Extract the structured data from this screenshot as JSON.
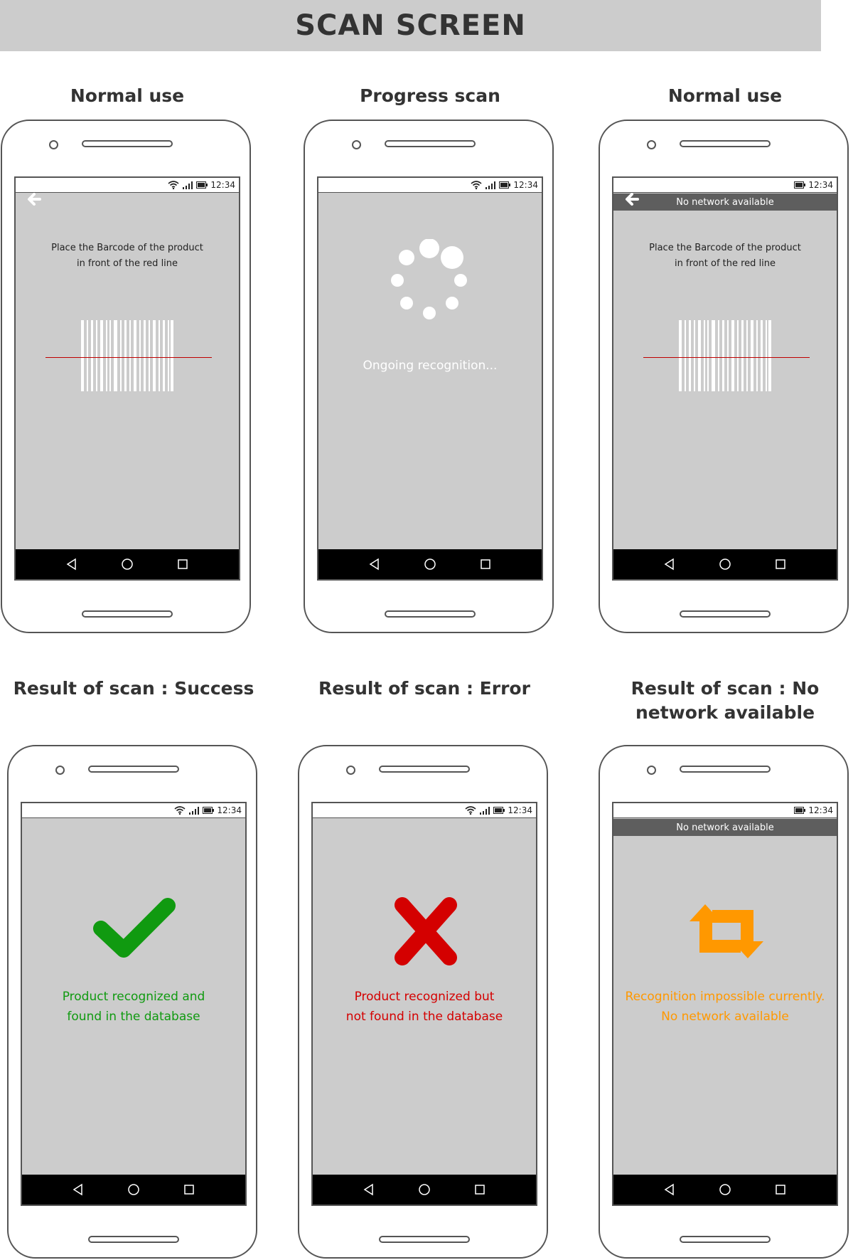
{
  "page": {
    "title": "SCAN SCREEN"
  },
  "status": {
    "time": "12:34"
  },
  "colors": {
    "success": "#109a10",
    "error": "#d40000",
    "warning": "#ff9800",
    "screen": "#cccccc",
    "scan_line": "#c00000"
  },
  "icons": {
    "wifi": "wifi-icon",
    "signal": "signal-icon",
    "battery": "battery-icon",
    "back": "back-arrow-icon",
    "nav_back": "nav-back-icon",
    "nav_home": "nav-home-icon",
    "nav_recent": "nav-recent-icon",
    "spinner": "loading-spinner-icon",
    "success": "checkmark-icon",
    "error": "cross-icon",
    "retry": "retry-icon"
  },
  "screens": [
    {
      "caption": "Normal use",
      "instruction_line1": "Place the Barcode of the product",
      "instruction_line2": "in front of the red line"
    },
    {
      "caption": "Progress scan",
      "message": "Ongoing recognition..."
    },
    {
      "caption": "Normal use",
      "banner": "No network available",
      "instruction_line1": "Place the Barcode of the product",
      "instruction_line2": "in front of the red line"
    },
    {
      "caption": "Result of scan : Success",
      "message_line1": "Product recognized and",
      "message_line2": "found in the database"
    },
    {
      "caption": "Result of scan : Error",
      "message_line1": "Product recognized but",
      "message_line2": "not found in the database"
    },
    {
      "caption_line1": "Result of scan : No",
      "caption_line2": "network available",
      "banner": "No network available",
      "message_line1": "Recognition impossible currently.",
      "message_line2": "No network available"
    }
  ]
}
